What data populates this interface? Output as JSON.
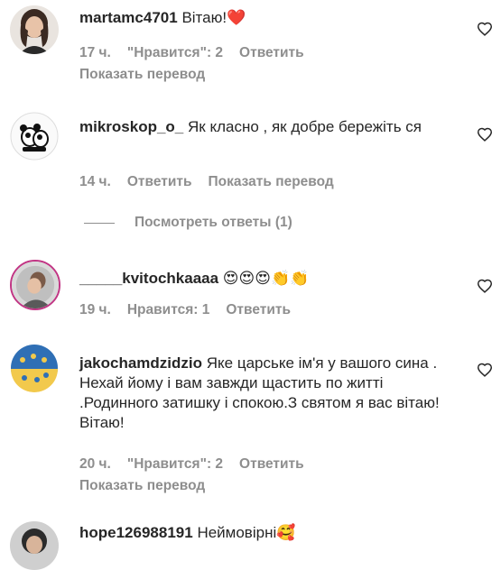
{
  "comments": [
    {
      "username": "martamc4701",
      "text": "Вітаю!",
      "emoji": "❤️",
      "time": "17 ч.",
      "likes": "\"Нравится\": 2",
      "reply": "Ответить",
      "translate": "Показать перевод"
    },
    {
      "username": "mikroskop_o_",
      "text": "Як класно , як добре бережіть ся",
      "time": "14 ч.",
      "reply": "Ответить",
      "translate": "Показать перевод",
      "view_replies": "Посмотреть ответы (1)"
    },
    {
      "username": "_____kvitochkaaaa",
      "emoji": "😍😍😍👏👏",
      "time": "19 ч.",
      "likes": "Нравится: 1",
      "reply": "Ответить"
    },
    {
      "username": "jakochamdzidzio",
      "text": "Яке царське ім'я у вашого сина . Нехай йому і вам завжди щастить по житті .Родинного затишку і спокою.З святом я вас вітаю! Вітаю!",
      "time": "20 ч.",
      "likes": "\"Нравится\": 2",
      "reply": "Ответить",
      "translate": "Показать перевод"
    },
    {
      "username": "hope126988191",
      "text": "Неймовірні",
      "emoji": "🥰"
    }
  ],
  "icons": {
    "like": "heart-outline-icon"
  },
  "colors": {
    "text": "#262626",
    "secondary": "#8e8e8e",
    "heart": "#ed4956"
  }
}
